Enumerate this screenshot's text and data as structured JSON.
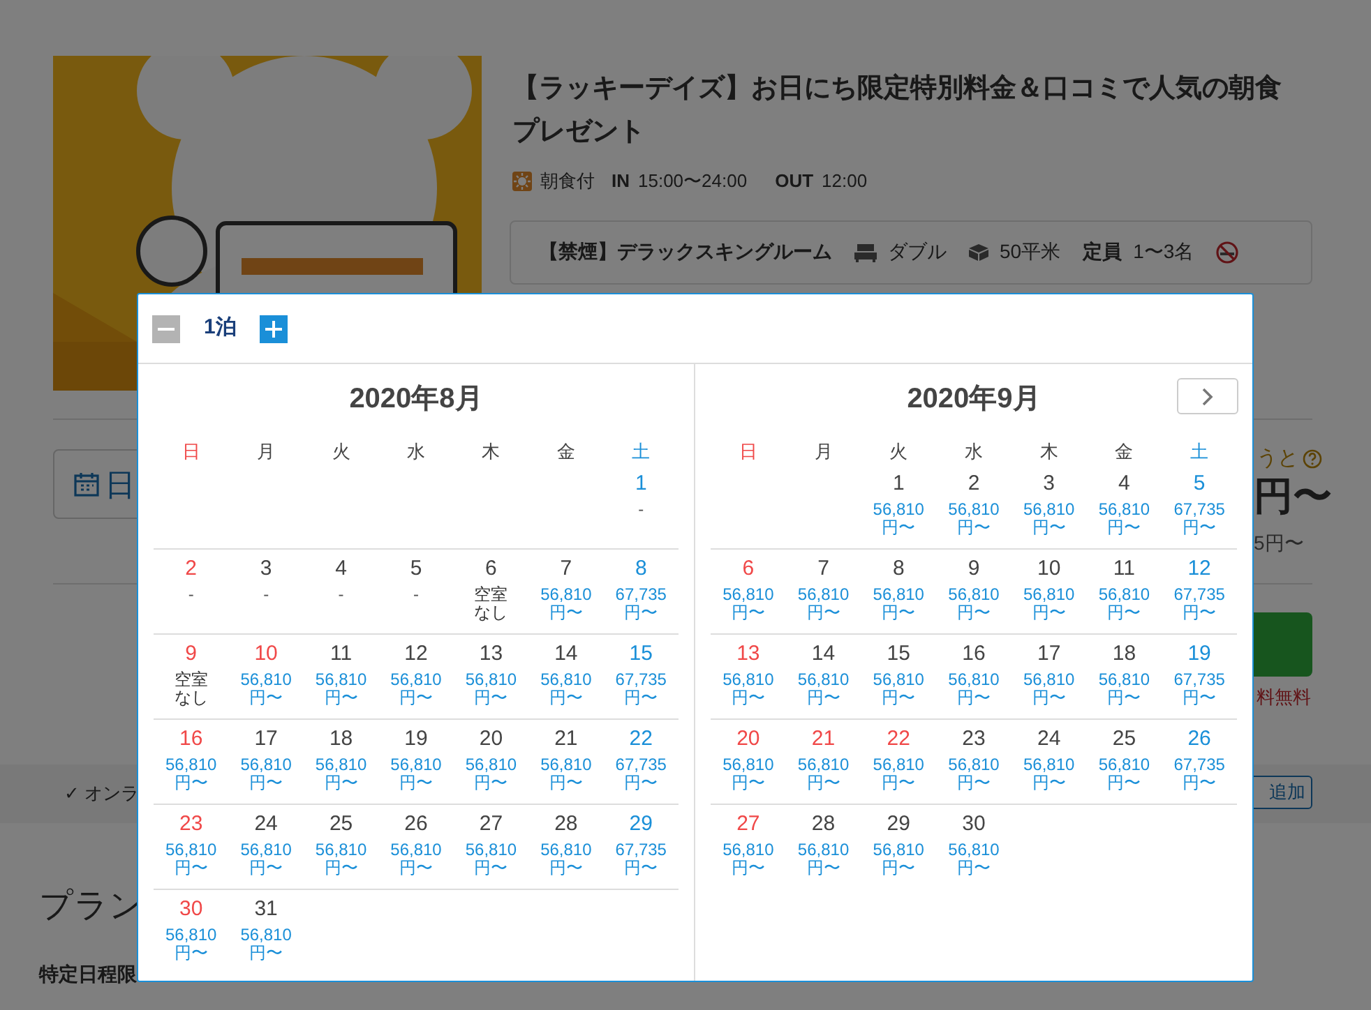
{
  "plan": {
    "title": "【ラッキーデイズ】お日にち限定特別料金＆口コミで人気の朝食プレゼント",
    "meal": "朝食付",
    "checkin_label": "IN",
    "checkin": "15:00〜24:00",
    "checkout_label": "OUT",
    "checkout": "12:00",
    "room": {
      "name": "【禁煙】デラックスキングルーム",
      "bed": "ダブル",
      "size": "50平米",
      "capacity_label": "定員",
      "capacity": "1〜3名"
    }
  },
  "date_field": {
    "value": "日"
  },
  "price_hint": "うと",
  "price": "円〜",
  "price_sub": "5円〜",
  "cancel_note": "料無料",
  "online_note": "✓ オンラ",
  "add_button": "追加",
  "section_title": "プラン",
  "section_note": "特定日程限",
  "calendar": {
    "nights": "1泊",
    "months": [
      {
        "title": "2020年8月",
        "weekdays": [
          "日",
          "月",
          "火",
          "水",
          "木",
          "金",
          "土"
        ],
        "weeks": [
          [
            {
              "day": "1",
              "holiday": false,
              "kind": "none",
              "note": [
                "-"
              ]
            }
          ],
          [
            {
              "day": "2",
              "holiday": true,
              "kind": "none",
              "note": [
                "-"
              ]
            },
            {
              "day": "3",
              "holiday": false,
              "kind": "none",
              "note": [
                "-"
              ]
            },
            {
              "day": "4",
              "holiday": false,
              "kind": "none",
              "note": [
                "-"
              ]
            },
            {
              "day": "5",
              "holiday": false,
              "kind": "none",
              "note": [
                "-"
              ]
            },
            {
              "day": "6",
              "holiday": false,
              "kind": "full",
              "note": [
                "空室",
                "なし"
              ]
            },
            {
              "day": "7",
              "holiday": false,
              "kind": "price",
              "note": [
                "56,810",
                "円〜"
              ]
            },
            {
              "day": "8",
              "holiday": false,
              "kind": "price",
              "note": [
                "67,735",
                "円〜"
              ]
            }
          ],
          [
            {
              "day": "9",
              "holiday": true,
              "kind": "full",
              "note": [
                "空室",
                "なし"
              ]
            },
            {
              "day": "10",
              "holiday": true,
              "kind": "price",
              "note": [
                "56,810",
                "円〜"
              ]
            },
            {
              "day": "11",
              "holiday": false,
              "kind": "price",
              "note": [
                "56,810",
                "円〜"
              ]
            },
            {
              "day": "12",
              "holiday": false,
              "kind": "price",
              "note": [
                "56,810",
                "円〜"
              ]
            },
            {
              "day": "13",
              "holiday": false,
              "kind": "price",
              "note": [
                "56,810",
                "円〜"
              ]
            },
            {
              "day": "14",
              "holiday": false,
              "kind": "price",
              "note": [
                "56,810",
                "円〜"
              ]
            },
            {
              "day": "15",
              "holiday": false,
              "kind": "price",
              "note": [
                "67,735",
                "円〜"
              ]
            }
          ],
          [
            {
              "day": "16",
              "holiday": true,
              "kind": "price",
              "note": [
                "56,810",
                "円〜"
              ]
            },
            {
              "day": "17",
              "holiday": false,
              "kind": "price",
              "note": [
                "56,810",
                "円〜"
              ]
            },
            {
              "day": "18",
              "holiday": false,
              "kind": "price",
              "note": [
                "56,810",
                "円〜"
              ]
            },
            {
              "day": "19",
              "holiday": false,
              "kind": "price",
              "note": [
                "56,810",
                "円〜"
              ]
            },
            {
              "day": "20",
              "holiday": false,
              "kind": "price",
              "note": [
                "56,810",
                "円〜"
              ]
            },
            {
              "day": "21",
              "holiday": false,
              "kind": "price",
              "note": [
                "56,810",
                "円〜"
              ]
            },
            {
              "day": "22",
              "holiday": false,
              "kind": "price",
              "note": [
                "67,735",
                "円〜"
              ]
            }
          ],
          [
            {
              "day": "23",
              "holiday": true,
              "kind": "price",
              "note": [
                "56,810",
                "円〜"
              ]
            },
            {
              "day": "24",
              "holiday": false,
              "kind": "price",
              "note": [
                "56,810",
                "円〜"
              ]
            },
            {
              "day": "25",
              "holiday": false,
              "kind": "price",
              "note": [
                "56,810",
                "円〜"
              ]
            },
            {
              "day": "26",
              "holiday": false,
              "kind": "price",
              "note": [
                "56,810",
                "円〜"
              ]
            },
            {
              "day": "27",
              "holiday": false,
              "kind": "price",
              "note": [
                "56,810",
                "円〜"
              ]
            },
            {
              "day": "28",
              "holiday": false,
              "kind": "price",
              "note": [
                "56,810",
                "円〜"
              ]
            },
            {
              "day": "29",
              "holiday": false,
              "kind": "price",
              "note": [
                "67,735",
                "円〜"
              ]
            }
          ],
          [
            {
              "day": "30",
              "holiday": true,
              "kind": "price",
              "note": [
                "56,810",
                "円〜"
              ]
            },
            {
              "day": "31",
              "holiday": false,
              "kind": "price",
              "note": [
                "56,810",
                "円〜"
              ]
            }
          ]
        ]
      },
      {
        "title": "2020年9月",
        "weekdays": [
          "日",
          "月",
          "火",
          "水",
          "木",
          "金",
          "土"
        ],
        "weeks": [
          [
            {
              "day": "1",
              "holiday": false,
              "kind": "price",
              "note": [
                "56,810",
                "円〜"
              ]
            },
            {
              "day": "2",
              "holiday": false,
              "kind": "price",
              "note": [
                "56,810",
                "円〜"
              ]
            },
            {
              "day": "3",
              "holiday": false,
              "kind": "price",
              "note": [
                "56,810",
                "円〜"
              ]
            },
            {
              "day": "4",
              "holiday": false,
              "kind": "price",
              "note": [
                "56,810",
                "円〜"
              ]
            },
            {
              "day": "5",
              "holiday": false,
              "kind": "price",
              "note": [
                "67,735",
                "円〜"
              ]
            }
          ],
          [
            {
              "day": "6",
              "holiday": true,
              "kind": "price",
              "note": [
                "56,810",
                "円〜"
              ]
            },
            {
              "day": "7",
              "holiday": false,
              "kind": "price",
              "note": [
                "56,810",
                "円〜"
              ]
            },
            {
              "day": "8",
              "holiday": false,
              "kind": "price",
              "note": [
                "56,810",
                "円〜"
              ]
            },
            {
              "day": "9",
              "holiday": false,
              "kind": "price",
              "note": [
                "56,810",
                "円〜"
              ]
            },
            {
              "day": "10",
              "holiday": false,
              "kind": "price",
              "note": [
                "56,810",
                "円〜"
              ]
            },
            {
              "day": "11",
              "holiday": false,
              "kind": "price",
              "note": [
                "56,810",
                "円〜"
              ]
            },
            {
              "day": "12",
              "holiday": false,
              "kind": "price",
              "note": [
                "67,735",
                "円〜"
              ]
            }
          ],
          [
            {
              "day": "13",
              "holiday": true,
              "kind": "price",
              "note": [
                "56,810",
                "円〜"
              ]
            },
            {
              "day": "14",
              "holiday": false,
              "kind": "price",
              "note": [
                "56,810",
                "円〜"
              ]
            },
            {
              "day": "15",
              "holiday": false,
              "kind": "price",
              "note": [
                "56,810",
                "円〜"
              ]
            },
            {
              "day": "16",
              "holiday": false,
              "kind": "price",
              "note": [
                "56,810",
                "円〜"
              ]
            },
            {
              "day": "17",
              "holiday": false,
              "kind": "price",
              "note": [
                "56,810",
                "円〜"
              ]
            },
            {
              "day": "18",
              "holiday": false,
              "kind": "price",
              "note": [
                "56,810",
                "円〜"
              ]
            },
            {
              "day": "19",
              "holiday": false,
              "kind": "price",
              "note": [
                "67,735",
                "円〜"
              ]
            }
          ],
          [
            {
              "day": "20",
              "holiday": true,
              "kind": "price",
              "note": [
                "56,810",
                "円〜"
              ]
            },
            {
              "day": "21",
              "holiday": true,
              "kind": "price",
              "note": [
                "56,810",
                "円〜"
              ]
            },
            {
              "day": "22",
              "holiday": true,
              "kind": "price",
              "note": [
                "56,810",
                "円〜"
              ]
            },
            {
              "day": "23",
              "holiday": false,
              "kind": "price",
              "note": [
                "56,810",
                "円〜"
              ]
            },
            {
              "day": "24",
              "holiday": false,
              "kind": "price",
              "note": [
                "56,810",
                "円〜"
              ]
            },
            {
              "day": "25",
              "holiday": false,
              "kind": "price",
              "note": [
                "56,810",
                "円〜"
              ]
            },
            {
              "day": "26",
              "holiday": false,
              "kind": "price",
              "note": [
                "67,735",
                "円〜"
              ]
            }
          ],
          [
            {
              "day": "27",
              "holiday": true,
              "kind": "price",
              "note": [
                "56,810",
                "円〜"
              ]
            },
            {
              "day": "28",
              "holiday": false,
              "kind": "price",
              "note": [
                "56,810",
                "円〜"
              ]
            },
            {
              "day": "29",
              "holiday": false,
              "kind": "price",
              "note": [
                "56,810",
                "円〜"
              ]
            },
            {
              "day": "30",
              "holiday": false,
              "kind": "price",
              "note": [
                "56,810",
                "円〜"
              ]
            }
          ]
        ]
      }
    ]
  }
}
